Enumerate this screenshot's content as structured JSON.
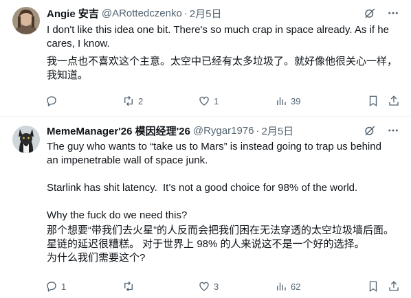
{
  "tweets": [
    {
      "author_name": "Angie 安吉",
      "handle": "@ARottedczenko",
      "separator": "·",
      "date": "2月5日",
      "lines": [
        "I don't like this idea one bit. There's so much crap in space already. As if he",
        "cares, I know.",
        "我一点也不喜欢这个主意。太空中已经有太多垃圾了。就好像他很关心一样，",
        "我知道。"
      ],
      "replies": "",
      "retweets": "2",
      "likes": "1",
      "views": "39"
    },
    {
      "author_name": "MemeManager'26 模因经理'26",
      "handle": "@Rygar1976",
      "separator": "·",
      "date": "2月5日",
      "lines": [
        "The guy who wants to “take us to Mars” is instead going to trap us behind",
        "an impenetrable wall of space junk.",
        "",
        "Starlink has shit latency.  It’s not a good choice for 98% of the world.",
        "",
        "Why the fuck do we need this?",
        "那个想要“带我们去火星”的人反而会把我们困在无法穿透的太空垃圾墙后面。",
        "星链的延迟很糟糕。 对于世界上 98% 的人来说这不是一个好的选择。",
        "为什么我们需要这个?"
      ],
      "replies": "1",
      "retweets": "",
      "likes": "3",
      "views": "62"
    }
  ],
  "colors": {
    "text": "#0f1419",
    "muted": "#536471",
    "divider": "#eff3f4"
  },
  "icons": [
    "reply-icon",
    "retweet-icon",
    "like-icon",
    "views-icon",
    "bookmark-icon",
    "share-icon",
    "grok-icon",
    "more-icon"
  ]
}
